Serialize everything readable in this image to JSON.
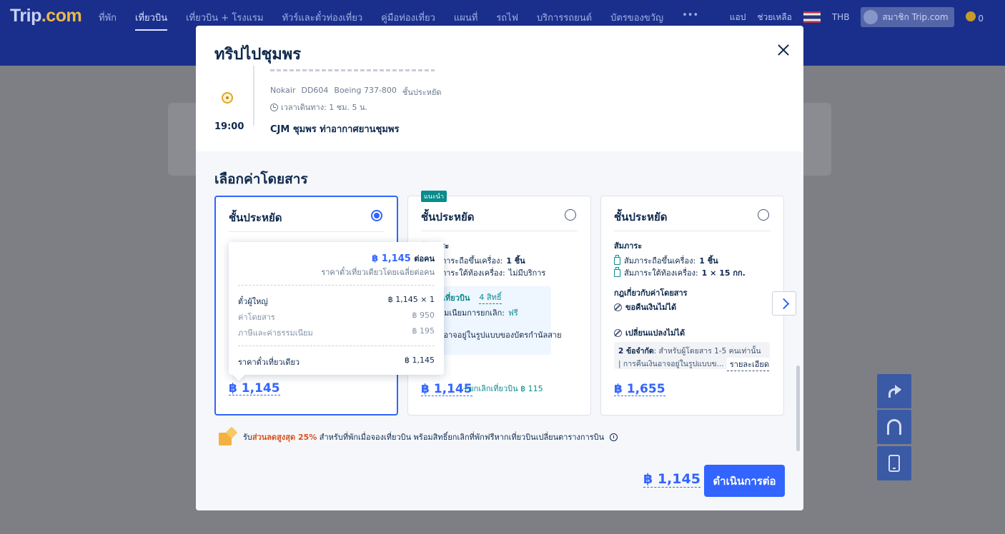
{
  "topbar": {
    "logo_main": "Trip",
    "logo_suffix": ".com",
    "nav": [
      "ที่พัก",
      "เที่ยวบิน",
      "เที่ยวบิน + โรงแรม",
      "ทัวร์และตั๋วท่องเที่ยว",
      "คู่มือท่องเที่ยว",
      "แผนที่",
      "รถไฟ",
      "บริการรถยนต์",
      "บัตรของขวัญ",
      "•••"
    ],
    "app": "แอป",
    "help": "ช่วยเหลือ",
    "currency": "THB",
    "member": "สมาชิก Trip.com",
    "points": "0"
  },
  "modal": {
    "title": "ทริปไปชุมพร",
    "itinerary": {
      "airline": "Nokair",
      "flight_no": "DD604",
      "aircraft": "Boeing 737-800",
      "cabin": "ชั้นประหยัด",
      "duration": "เวลาเดินทาง: 1 ชม. 5 น.",
      "arrival_time": "19:00",
      "arrival_airport": "CJM ชุมพร ท่าอากาศยานชุมพร"
    },
    "fare_heading": "เลือกค่าโดยสาร",
    "cards": [
      {
        "name": "ชั้นประหยัด",
        "price": "฿ 1,145",
        "selected": true
      },
      {
        "name": "ชั้นประหยัด",
        "badge": "แนะนำ",
        "baggage_heading": "สัมภาระ",
        "carry_on_label": "สัมภาระถือขึ้นเครื่อง:",
        "carry_on_value": "1 ชิ้น",
        "checked_label": "สัมภาระใต้ท้องเครื่อง:",
        "checked_value": "ไม่มีบริการ",
        "insurance_label": "ยกเลิกเที่ยวบิน",
        "insurance_benefits": "4 สิทธิ์",
        "cancel_fee_label": "ค่าธรรมเนียมการยกเลิก:",
        "cancel_fee_value": "ฟรี",
        "refund_note": "คืนเงินอาจอยู่ในรูปแบบของบัตรกำนัลสาย",
        "price": "฿ 1,145",
        "addon": "+ยกเลิกเที่ยวบิน ฿ 115"
      },
      {
        "name": "ชั้นประหยัด",
        "baggage_heading": "สัมภาระ",
        "carry_on_label": "สัมภาระถือขึ้นเครื่อง:",
        "carry_on_value": "1 ชิ้น",
        "checked_label": "สัมภาระใต้ท้องเครื่อง:",
        "checked_value": "1 × 15 กก.",
        "rules_heading": "กฎเกี่ยวกับค่าโดยสาร",
        "refund": "ขอคืนเงินไม่ได้",
        "change": "เปลี่ยนแปลงไม่ได้",
        "limit_title": "2 ข้อจำกัด",
        "limit_text": ": สำหรับผู้โดยสาร 1-5 คนเท่านั้น | การคืนเงินอาจอยู่ในรูปแบบข...",
        "details_link": "รายละเอียด",
        "price": "฿ 1,655"
      }
    ],
    "tooltip": {
      "price": "฿ 1,145",
      "per_person": "ต่อคน",
      "note": "ราคาตั๋วเที่ยวเดียวโดยเฉลี่ยต่อคน",
      "adult_label": "ตั๋วผู้ใหญ่",
      "adult_value": "฿ 1,145 × 1",
      "fare_label": "ค่าโดยสาร",
      "fare_value": "฿ 950",
      "tax_label": "ภาษีและค่าธรรมเนียม",
      "tax_value": "฿ 195",
      "total_label": "ราคาตั๋วเที่ยวเดียว",
      "total_value": "฿ 1,145"
    },
    "promo": {
      "prefix": "รับ",
      "highlight": "ส่วนลดสูงสุด 25%",
      "text": " สำหรับที่พักเมื่อจองเที่ยวบิน พร้อมสิทธิ์ยกเลิกที่พักฟรีหากเที่ยวบินเปลี่ยนตารางการบิน"
    },
    "footer_price": "฿ 1,145",
    "continue_label": "ดำเนินการต่อ"
  },
  "colors": {
    "primary": "#3264ff",
    "teal": "#0a8c8c",
    "text": "#0f294d",
    "promo_highlight": "#d9531e"
  }
}
